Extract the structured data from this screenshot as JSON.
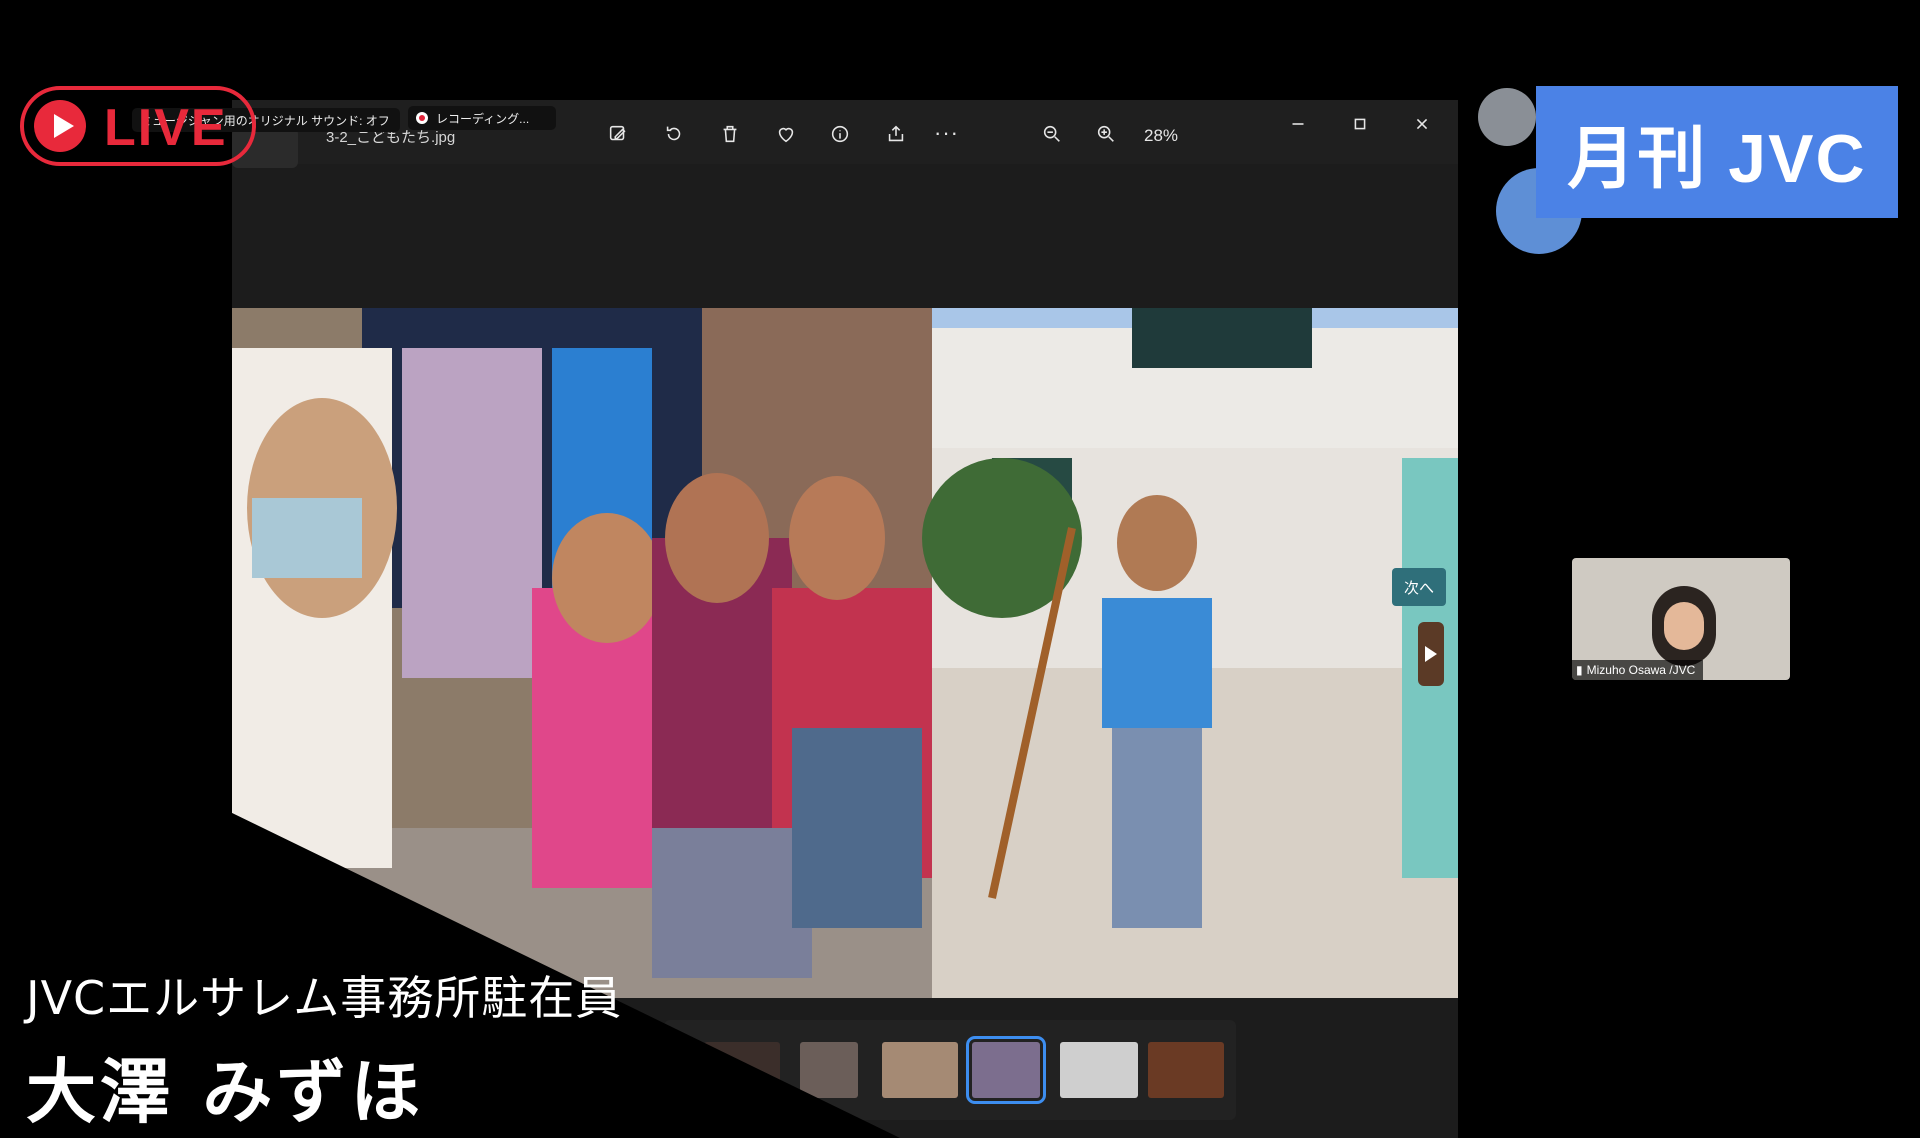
{
  "viewer": {
    "file_name": "3-2_こどもたち.jpg",
    "zoom": "28%",
    "toolbar_icons": [
      "edit-icon",
      "rotate-icon",
      "delete-icon",
      "favorite-icon",
      "info-icon",
      "share-icon",
      "more-icon"
    ],
    "zoom_icons": [
      "zoom-out-icon",
      "zoom-in-icon"
    ],
    "window_controls": [
      "minimize-icon",
      "maximize-icon",
      "close-icon"
    ],
    "more_label": "···",
    "thumbnails_count": 6,
    "selected_thumbnail": 4
  },
  "recording": {
    "sound_chip": "ミュージシャン用のオリジナル サウンド: オフ",
    "rec_chip": "レコーディング..."
  },
  "live_badge": "LIVE",
  "brand": "月刊 JVC",
  "participant": {
    "name": "Mizuho Osawa /JVC"
  },
  "next_label": "次へ",
  "lower_third": {
    "title": "JVCエルサレム事務所駐在員",
    "name": "大澤 みずほ"
  },
  "colors": {
    "live_red": "#e8293b",
    "brand_blue": "#4b82e6",
    "selection_blue": "#3d8ef0"
  }
}
